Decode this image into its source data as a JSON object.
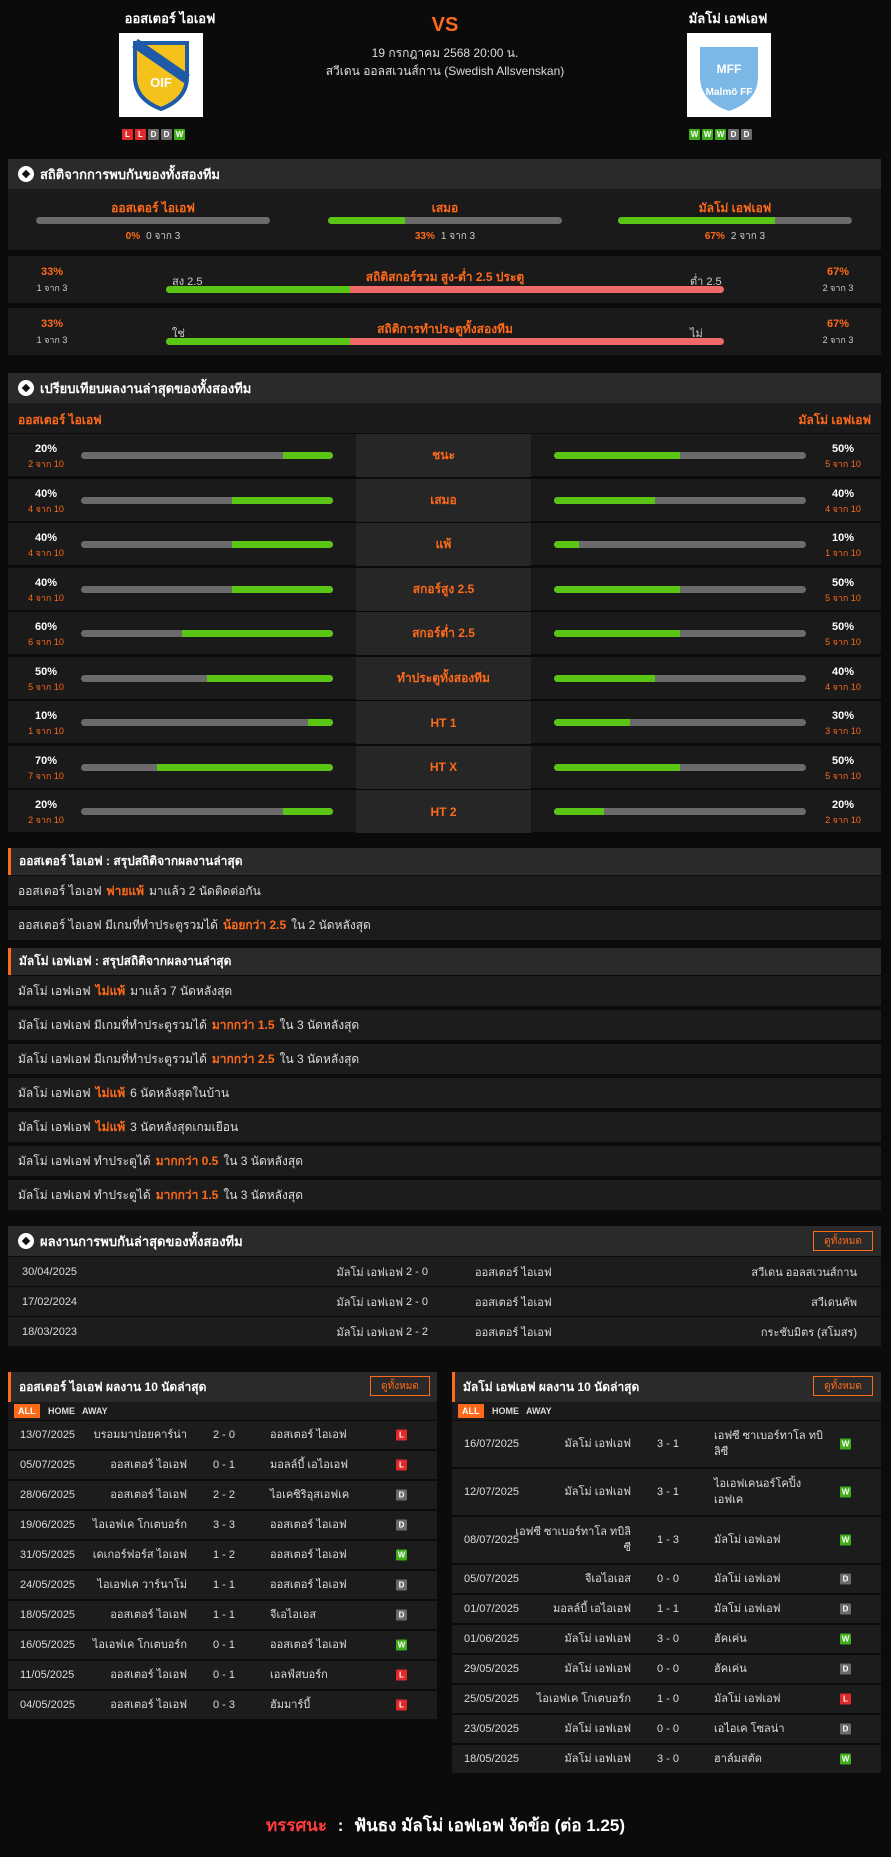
{
  "header": {
    "home_name": "ออสเตอร์ ไอเอฟ",
    "away_name": "มัลโม่ เอฟเอฟ",
    "vs": "VS",
    "datetime": "19 กรกฎาคม 2568 20:00 น.",
    "league": "สวีเดน ออลสเวนส์กาน (Swedish Allsvenskan)",
    "home_logo_text": "OIF",
    "away_logo_text": "Malmö FF",
    "away_logo_top": "MFF",
    "home_form": [
      "L",
      "L",
      "D",
      "D",
      "W"
    ],
    "away_form": [
      "W",
      "W",
      "W",
      "D",
      "D"
    ]
  },
  "h2h_stats": {
    "title": "สถิติจากการพบกันของทั้งสองทีม",
    "cols": [
      {
        "label": "ออสเตอร์ ไอเอฟ",
        "pct": "0%",
        "sub": "0 จาก 3",
        "fill": 0
      },
      {
        "label": "เสมอ",
        "pct": "33%",
        "sub": "1 จาก 3",
        "fill": 33
      },
      {
        "label": "มัลโม่ เอฟเอฟ",
        "pct": "67%",
        "sub": "2 จาก 3",
        "fill": 67
      }
    ],
    "ou": {
      "left_pct": "33%",
      "left_sub": "1 จาก 3",
      "left_label": "สูง 2.5",
      "title": "สถิติสกอร์รวม สูง-ต่ำ 2.5 ประตู",
      "right_label": "ต่ำ 2.5",
      "right_pct": "67%",
      "right_sub": "2 จาก 3",
      "green": 33
    },
    "btts": {
      "left_pct": "33%",
      "left_sub": "1 จาก 3",
      "left_label": "ใช่",
      "title": "สถิติการทำประตูทั้งสองทีม",
      "right_label": "ไม่",
      "right_pct": "67%",
      "right_sub": "2 จาก 3",
      "green": 33
    }
  },
  "recent_cmp": {
    "title": "เปรียบเทียบผลงานล่าสุดของทั้งสองทีม",
    "home": "ออสเตอร์ ไอเอฟ",
    "away": "มัลโม่ เอฟเอฟ",
    "rows": [
      {
        "label": "ชนะ",
        "hp": "20%",
        "hs": "2 จาก 10",
        "hv": 20,
        "ap": "50%",
        "as": "5 จาก 10",
        "av": 50
      },
      {
        "label": "เสมอ",
        "hp": "40%",
        "hs": "4 จาก 10",
        "hv": 40,
        "ap": "40%",
        "as": "4 จาก 10",
        "av": 40
      },
      {
        "label": "แพ้",
        "hp": "40%",
        "hs": "4 จาก 10",
        "hv": 40,
        "ap": "10%",
        "as": "1 จาก 10",
        "av": 10
      },
      {
        "label": "สกอร์สูง 2.5",
        "hp": "40%",
        "hs": "4 จาก 10",
        "hv": 40,
        "ap": "50%",
        "as": "5 จาก 10",
        "av": 50
      },
      {
        "label": "สกอร์ต่ำ 2.5",
        "hp": "60%",
        "hs": "6 จาก 10",
        "hv": 60,
        "ap": "50%",
        "as": "5 จาก 10",
        "av": 50
      },
      {
        "label": "ทำประตูทั้งสองทีม",
        "hp": "50%",
        "hs": "5 จาก 10",
        "hv": 50,
        "ap": "40%",
        "as": "4 จาก 10",
        "av": 40
      },
      {
        "label": "HT 1",
        "hp": "10%",
        "hs": "1 จาก 10",
        "hv": 10,
        "ap": "30%",
        "as": "3 จาก 10",
        "av": 30
      },
      {
        "label": "HT X",
        "hp": "70%",
        "hs": "7 จาก 10",
        "hv": 70,
        "ap": "50%",
        "as": "5 จาก 10",
        "av": 50
      },
      {
        "label": "HT 2",
        "hp": "20%",
        "hs": "2 จาก 10",
        "hv": 20,
        "ap": "20%",
        "as": "2 จาก 10",
        "av": 20
      }
    ]
  },
  "home_summary": {
    "title": "ออสเตอร์ ไอเอฟ : สรุปสถิติจากผลงานล่าสุด",
    "rows": [
      {
        "a": "ออสเตอร์ ไอเอฟ",
        "b": "พ่ายแพ้",
        "c": "มาแล้ว 2 นัดติดต่อกัน"
      },
      {
        "a": "ออสเตอร์ ไอเอฟ มีเกมที่ทำประตูรวมได้",
        "b": "น้อยกว่า 2.5",
        "c": "ใน 2 นัดหลังสุด"
      }
    ]
  },
  "away_summary": {
    "title": "มัลโม่ เอฟเอฟ : สรุปสถิติจากผลงานล่าสุด",
    "rows": [
      {
        "a": "มัลโม่ เอฟเอฟ",
        "b": "ไม่แพ้",
        "c": "มาแล้ว 7 นัดหลังสุด"
      },
      {
        "a": "มัลโม่ เอฟเอฟ มีเกมที่ทำประตูรวมได้",
        "b": "มากกว่า 1.5",
        "c": "ใน 3 นัดหลังสุด"
      },
      {
        "a": "มัลโม่ เอฟเอฟ มีเกมที่ทำประตูรวมได้",
        "b": "มากกว่า 2.5",
        "c": "ใน 3 นัดหลังสุด"
      },
      {
        "a": "มัลโม่ เอฟเอฟ",
        "b": "ไม่แพ้",
        "c": "6 นัดหลังสุดในบ้าน"
      },
      {
        "a": "มัลโม่ เอฟเอฟ",
        "b": "ไม่แพ้",
        "c": "3 นัดหลังสุดเกมเยือน"
      },
      {
        "a": "มัลโม่ เอฟเอฟ ทำประตูได้",
        "b": "มากกว่า 0.5",
        "c": "ใน 3 นัดหลังสุด"
      },
      {
        "a": "มัลโม่ เอฟเอฟ ทำประตูได้",
        "b": "มากกว่า 1.5",
        "c": "ใน 3 นัดหลังสุด"
      }
    ]
  },
  "h2h_results": {
    "title": "ผลงานการพบกันล่าสุดของทั้งสองทีม",
    "btn": "ดูทั้งหมด",
    "rows": [
      {
        "date": "30/04/2025",
        "home": "มัลโม่ เอฟเอฟ",
        "score": "2 - 0",
        "away": "ออสเตอร์ ไอเอฟ",
        "comp": "สวีเดน ออลสเวนส์กาน"
      },
      {
        "date": "17/02/2024",
        "home": "มัลโม่ เอฟเอฟ",
        "score": "2 - 0",
        "away": "ออสเตอร์ ไอเอฟ",
        "comp": "สวีเดนคัพ"
      },
      {
        "date": "18/03/2023",
        "home": "มัลโม่ เอฟเอฟ",
        "score": "2 - 2",
        "away": "ออสเตอร์ ไอเอฟ",
        "comp": "กระชับมิตร (สโมสร)"
      }
    ]
  },
  "tabs": {
    "all": "ALL",
    "home": "HOME",
    "away": "AWAY"
  },
  "home_last10": {
    "title": "ออสเตอร์ ไอเอฟ ผลงาน 10 นัดล่าสุด",
    "btn": "ดูทั้งหมด",
    "rows": [
      {
        "date": "13/07/2025",
        "home": "บรอมมาปอยคาร์น่า",
        "score": "2 - 0",
        "away": "ออสเตอร์ ไอเอฟ",
        "res": "L"
      },
      {
        "date": "05/07/2025",
        "home": "ออสเตอร์ ไอเอฟ",
        "score": "0 - 1",
        "away": "มอลล์บี้ เอไอเอฟ",
        "res": "L"
      },
      {
        "date": "28/06/2025",
        "home": "ออสเตอร์ ไอเอฟ",
        "score": "2 - 2",
        "away": "ไอเคซิริอุสเอฟเค",
        "res": "D"
      },
      {
        "date": "19/06/2025",
        "home": "ไอเอฟเค โกเตบอร์ก",
        "score": "3 - 3",
        "away": "ออสเตอร์ ไอเอฟ",
        "res": "D"
      },
      {
        "date": "31/05/2025",
        "home": "เดเกอร์ฟอร์ส ไอเอฟ",
        "score": "1 - 2",
        "away": "ออสเตอร์ ไอเอฟ",
        "res": "W"
      },
      {
        "date": "24/05/2025",
        "home": "ไอเอฟเค วาร์นาโม่",
        "score": "1 - 1",
        "away": "ออสเตอร์ ไอเอฟ",
        "res": "D"
      },
      {
        "date": "18/05/2025",
        "home": "ออสเตอร์ ไอเอฟ",
        "score": "1 - 1",
        "away": "จีเอไอเอส",
        "res": "D"
      },
      {
        "date": "16/05/2025",
        "home": "ไอเอฟเค โกเตบอร์ก",
        "score": "0 - 1",
        "away": "ออสเตอร์ ไอเอฟ",
        "res": "W"
      },
      {
        "date": "11/05/2025",
        "home": "ออสเตอร์ ไอเอฟ",
        "score": "0 - 1",
        "away": "เอลฟ์สบอร์ก",
        "res": "L"
      },
      {
        "date": "04/05/2025",
        "home": "ออสเตอร์ ไอเอฟ",
        "score": "0 - 3",
        "away": "ฮัมมาร์บี้",
        "res": "L"
      }
    ]
  },
  "away_last10": {
    "title": "มัลโม่ เอฟเอฟ ผลงาน 10 นัดล่าสุด",
    "btn": "ดูทั้งหมด",
    "rows": [
      {
        "date": "16/07/2025",
        "home": "มัลโม่ เอฟเอฟ",
        "score": "3 - 1",
        "away": "เอฟซี ซาเบอร์ทาโล ทบิลิซี",
        "res": "W"
      },
      {
        "date": "12/07/2025",
        "home": "มัลโม่ เอฟเอฟ",
        "score": "3 - 1",
        "away": "ไอเอฟเคนอร์โคปิ้ง เอฟเค",
        "res": "W"
      },
      {
        "date": "08/07/2025",
        "home": "เอฟซี ซาเบอร์ทาโล ทบิลิซี",
        "score": "1 - 3",
        "away": "มัลโม่ เอฟเอฟ",
        "res": "W"
      },
      {
        "date": "05/07/2025",
        "home": "จีเอไอเอส",
        "score": "0 - 0",
        "away": "มัลโม่ เอฟเอฟ",
        "res": "D"
      },
      {
        "date": "01/07/2025",
        "home": "มอลล์บี้ เอไอเอฟ",
        "score": "1 - 1",
        "away": "มัลโม่ เอฟเอฟ",
        "res": "D"
      },
      {
        "date": "01/06/2025",
        "home": "มัลโม่ เอฟเอฟ",
        "score": "3 - 0",
        "away": "ฮัคเค่น",
        "res": "W"
      },
      {
        "date": "29/05/2025",
        "home": "มัลโม่ เอฟเอฟ",
        "score": "0 - 0",
        "away": "ฮัคเค่น",
        "res": "D"
      },
      {
        "date": "25/05/2025",
        "home": "ไอเอฟเค โกเตบอร์ก",
        "score": "1 - 0",
        "away": "มัลโม่ เอฟเอฟ",
        "res": "L"
      },
      {
        "date": "23/05/2025",
        "home": "มัลโม่ เอฟเอฟ",
        "score": "0 - 0",
        "away": "เอไอเค โซลน่า",
        "res": "D"
      },
      {
        "date": "18/05/2025",
        "home": "มัลโม่ เอฟเอฟ",
        "score": "3 - 0",
        "away": "ฮาล์มสตัด",
        "res": "W"
      }
    ]
  },
  "prediction": {
    "label": "ทรรศนะ",
    "sep": ":",
    "text": "ฟันธง มัลโม่ เอฟเอฟ งัดข้อ (ต่อ 1.25)"
  },
  "colors": {
    "accent": "#ff6a1a",
    "green": "#5bc514",
    "red": "#e02a2a",
    "bg": "#0b0b0b"
  }
}
